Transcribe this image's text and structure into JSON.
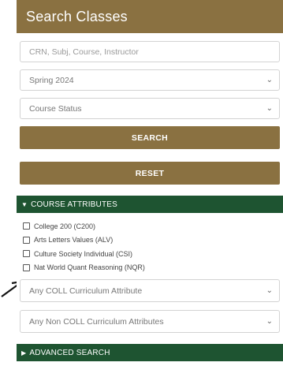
{
  "header": {
    "title": "Search Classes"
  },
  "search": {
    "placeholder": "CRN, Subj, Course, Instructor"
  },
  "term_select": {
    "value": "Spring 2024"
  },
  "status_select": {
    "value": "Course Status"
  },
  "buttons": {
    "search_label": "SEARCH",
    "reset_label": "RESET"
  },
  "course_attributes": {
    "title": "COURSE ATTRIBUTES",
    "items": [
      {
        "label": "College 200 (C200)"
      },
      {
        "label": "Arts Letters Values (ALV)"
      },
      {
        "label": "Culture Society Individual (CSI)"
      },
      {
        "label": "Nat World Quant Reasoning (NQR)"
      }
    ],
    "coll_select": {
      "value": "Any COLL Curriculum Attribute"
    },
    "non_coll_select": {
      "value": "Any Non COLL Curriculum Attributes"
    }
  },
  "advanced": {
    "title": "ADVANCED SEARCH"
  },
  "colors": {
    "header_gold": "#8a7141",
    "section_green": "#1e5431",
    "field_border": "#d3d3d3"
  },
  "icons": {
    "select_arrow": "chevron-down-icon",
    "section_expanded": "caret-down-icon",
    "section_collapsed": "caret-right-icon"
  }
}
